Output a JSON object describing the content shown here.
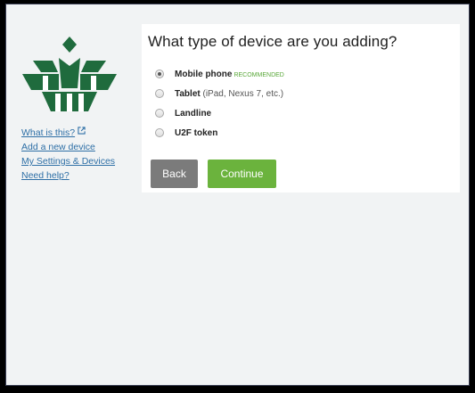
{
  "sidebar": {
    "links": [
      {
        "label": "What is this?"
      },
      {
        "label": "Add a new device"
      },
      {
        "label": "My Settings & Devices"
      },
      {
        "label": "Need help?"
      }
    ]
  },
  "main": {
    "title": "What type of device are you adding?",
    "options": [
      {
        "name": "Mobile phone",
        "badge": "RECOMMENDED",
        "selected": true
      },
      {
        "name": "Tablet",
        "note": "(iPad, Nexus 7, etc.)",
        "selected": false
      },
      {
        "name": "Landline",
        "selected": false
      },
      {
        "name": "U2F token",
        "selected": false
      }
    ],
    "back_label": "Back",
    "continue_label": "Continue"
  },
  "colors": {
    "logo_green": "#1f6b3d",
    "continue_green": "#6bb33d",
    "back_gray": "#7b7b7b",
    "link_blue": "#2e6fa6"
  },
  "icons": [
    "organization-logo",
    "external-link-icon",
    "radio-selected",
    "radio-unselected"
  ]
}
